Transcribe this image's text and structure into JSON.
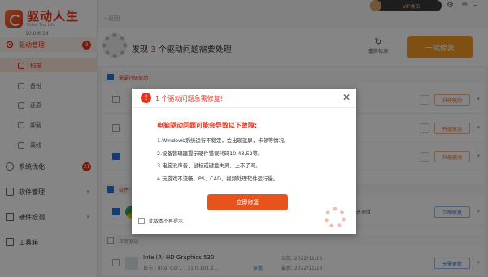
{
  "app": {
    "title": "驱动人生",
    "subtitle": "Drive The Life",
    "version": "10.0.6.16"
  },
  "sidebar": {
    "items": [
      {
        "label": "驱动管理",
        "badge": "3"
      },
      {
        "label": "系统优化",
        "badge": "21"
      },
      {
        "label": "软件管理"
      },
      {
        "label": "硬件检测"
      },
      {
        "label": "工具箱"
      }
    ],
    "sub_items": [
      {
        "label": "扫描"
      },
      {
        "label": "备份"
      },
      {
        "label": "还原"
      },
      {
        "label": "卸载"
      },
      {
        "label": "离线"
      }
    ]
  },
  "header": {
    "back_label": "返回",
    "vip_label": "VIP会员"
  },
  "summary": {
    "prefix": "发现",
    "count": "3",
    "suffix": "个驱动问题需要处理",
    "rescan_label": "重新检测",
    "fix_all_label": "一键修复"
  },
  "list": {
    "section_update": "需要升级驱动",
    "section_software": "软件",
    "section_normal": "正常驱动",
    "rows": [
      {
        "button": "升级驱动"
      },
      {
        "button": "升级驱动"
      },
      {
        "button": "升级驱动"
      },
      {
        "speed": "开速度",
        "button": "立即修复"
      },
      {
        "title": "Intel(R) HD Graphics 530",
        "sub": "显卡 | Intel Cor... | 31.0.101.2...",
        "detail": "详情",
        "date1": "当前: 2022/11/16",
        "date2": "最新: 2022/11/16",
        "button": "无需更新"
      }
    ]
  },
  "dialog": {
    "title": "1 个驱动问题急需修复!",
    "heading": "电脑驱动问题可能会导致以下故障:",
    "lines": [
      "1.Windows系统运行不稳定，会出现蓝屏，卡顿等情况。",
      "2.设备管理器提示硬件错误代码10,43,52等。",
      "3.电脑没声音，鼠标或键盘失灵，上不了网。",
      "4.玩游戏不流畅，PS，CAD，视频处理软件运行慢。"
    ],
    "fix_button": "立即修复",
    "dont_remind": "此版本不再提示"
  },
  "colors": {
    "accent": "#e8331c",
    "orange": "#f59a23",
    "blue": "#2d6fd6"
  }
}
